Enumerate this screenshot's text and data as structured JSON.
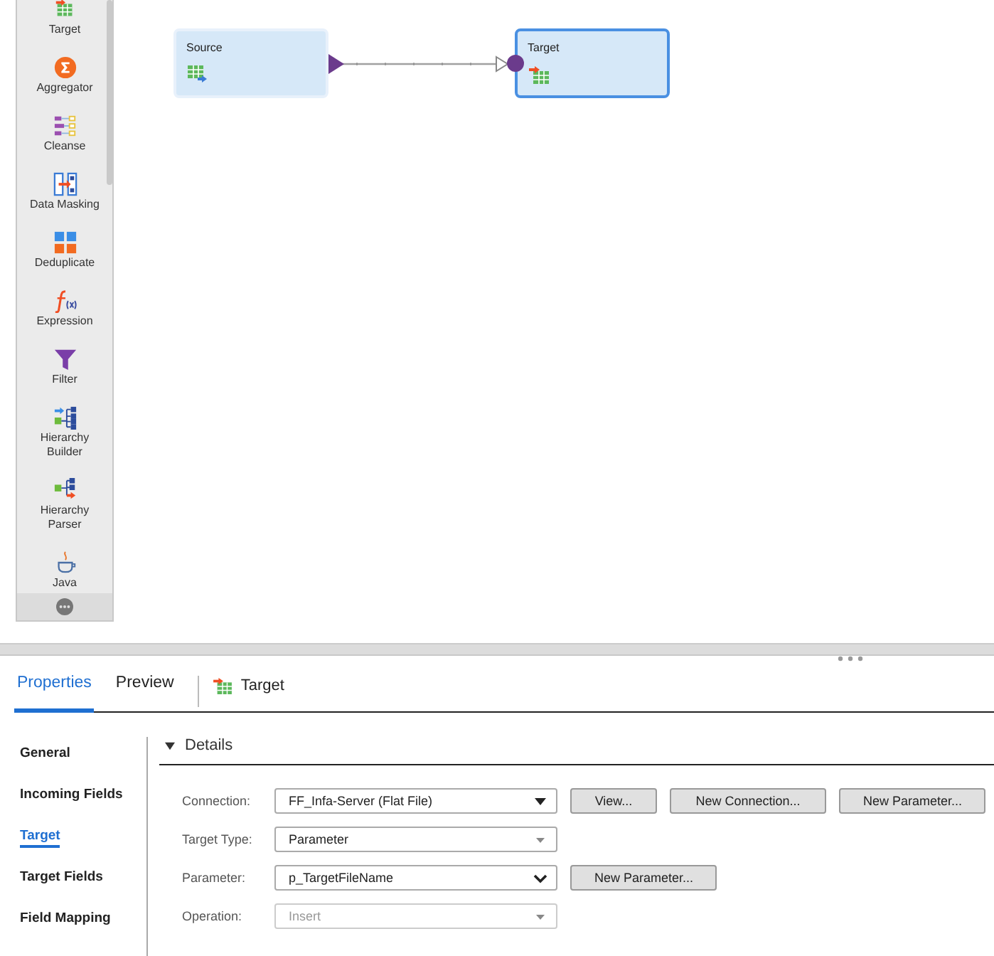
{
  "palette": {
    "items": [
      {
        "label": "Target"
      },
      {
        "label": "Aggregator"
      },
      {
        "label": "Cleanse"
      },
      {
        "label": "Data Masking"
      },
      {
        "label": "Deduplicate"
      },
      {
        "label": "Expression"
      },
      {
        "label": "Filter"
      },
      {
        "label": "Hierarchy Builder"
      },
      {
        "label": "Hierarchy Parser"
      },
      {
        "label": "Java"
      }
    ]
  },
  "canvas": {
    "nodes": [
      {
        "kind": "source",
        "title": "Source",
        "selected": false
      },
      {
        "kind": "target",
        "title": "Target",
        "selected": true
      }
    ]
  },
  "panel": {
    "tabs": [
      {
        "label": "Properties",
        "selected": true
      },
      {
        "label": "Preview",
        "selected": false
      }
    ],
    "object": {
      "title": "Target"
    },
    "nav": [
      {
        "label": "General",
        "selected": false
      },
      {
        "label": "Incoming Fields",
        "selected": false
      },
      {
        "label": "Target",
        "selected": true
      },
      {
        "label": "Target Fields",
        "selected": false
      },
      {
        "label": "Field Mapping",
        "selected": false
      }
    ],
    "section": {
      "title": "Details",
      "expanded": true
    },
    "fields": [
      {
        "label": "Connection:",
        "value": "FF_Infa-Server (Flat File)",
        "kind": "solid",
        "disabled": false,
        "buttons": [
          "View...",
          "New Connection...",
          "New Parameter..."
        ]
      },
      {
        "label": "Target Type:",
        "value": "Parameter",
        "kind": "light",
        "disabled": false
      },
      {
        "label": "Parameter:",
        "value": "p_TargetFileName",
        "kind": "chevron",
        "disabled": false,
        "buttons": [
          "New Parameter..."
        ]
      },
      {
        "label": "Operation:",
        "value": "Insert",
        "kind": "light",
        "disabled": true
      }
    ]
  }
}
